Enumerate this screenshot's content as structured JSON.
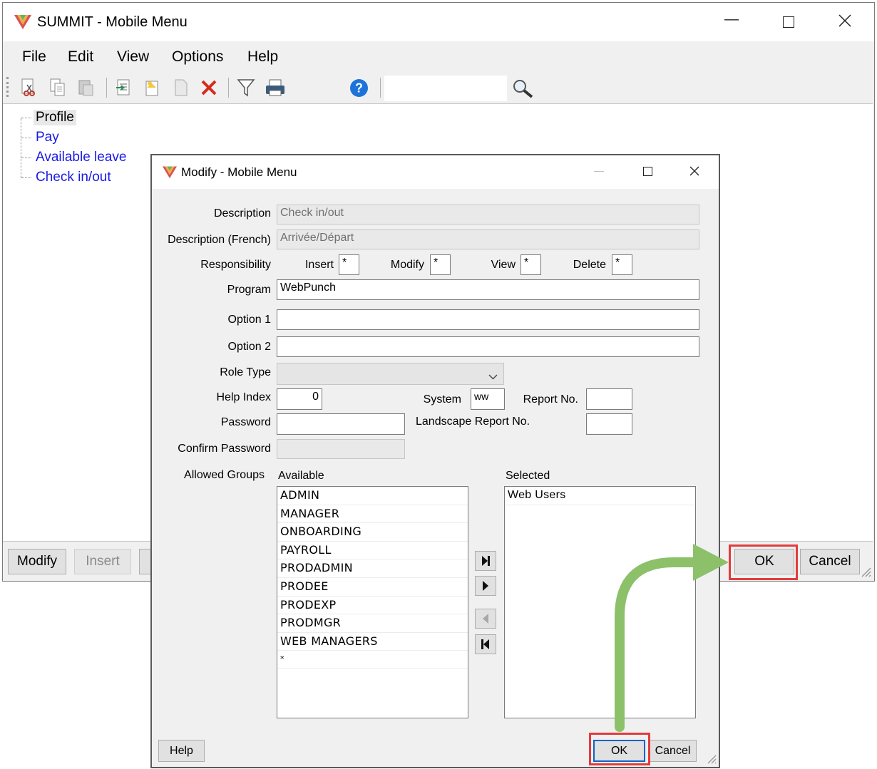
{
  "main": {
    "title": "SUMMIT - Mobile Menu",
    "menu": [
      "File",
      "Edit",
      "View",
      "Options",
      "Help"
    ],
    "tree": [
      "Profile",
      "Pay",
      "Available leave",
      "Check in/out"
    ],
    "bottom_buttons": {
      "modify": "Modify",
      "insert": "Insert",
      "ok": "OK",
      "cancel": "Cancel"
    },
    "toolbar_icons": [
      "cut-icon",
      "copy-icon",
      "paste-icon",
      "import-icon",
      "new-folder-icon",
      "blank-page-icon",
      "delete-icon",
      "filter-icon",
      "print-icon",
      "help-icon",
      "search-icon"
    ]
  },
  "dialog": {
    "title": "Modify - Mobile Menu",
    "labels": {
      "description": "Description",
      "description_fr": "Description (French)",
      "responsibility": "Responsibility",
      "insert": "Insert",
      "modify": "Modify",
      "view": "View",
      "delete": "Delete",
      "program": "Program",
      "option1": "Option 1",
      "option2": "Option 2",
      "role_type": "Role Type",
      "help_index": "Help Index",
      "system": "System",
      "report_no": "Report No.",
      "password": "Password",
      "landscape_report_no": "Landscape Report No.",
      "confirm_password": "Confirm Password",
      "allowed_groups": "Allowed Groups",
      "available": "Available",
      "selected": "Selected"
    },
    "values": {
      "description": "Check in/out",
      "description_fr": "Arrivée/Départ",
      "insert": "*",
      "modify": "*",
      "view": "*",
      "delete": "*",
      "program": "WebPunch",
      "option1": "",
      "option2": "",
      "role_type": "",
      "help_index": "0",
      "system": "ww",
      "report_no": "",
      "password": "",
      "landscape_report_no": "",
      "confirm_password": ""
    },
    "available_groups": [
      "ADMIN",
      "MANAGER",
      "ONBOARDING",
      "PAYROLL",
      "PRODADMIN",
      "PRODEE",
      "PRODEXP",
      "PRODMGR",
      "WEB MANAGERS",
      "*"
    ],
    "selected_groups": [
      "Web Users"
    ],
    "buttons": {
      "help": "Help",
      "ok": "OK",
      "cancel": "Cancel"
    }
  },
  "colors": {
    "highlight": "#e33b3b",
    "arrow": "#8cc16a",
    "tree_link": "#1a1ae6"
  }
}
